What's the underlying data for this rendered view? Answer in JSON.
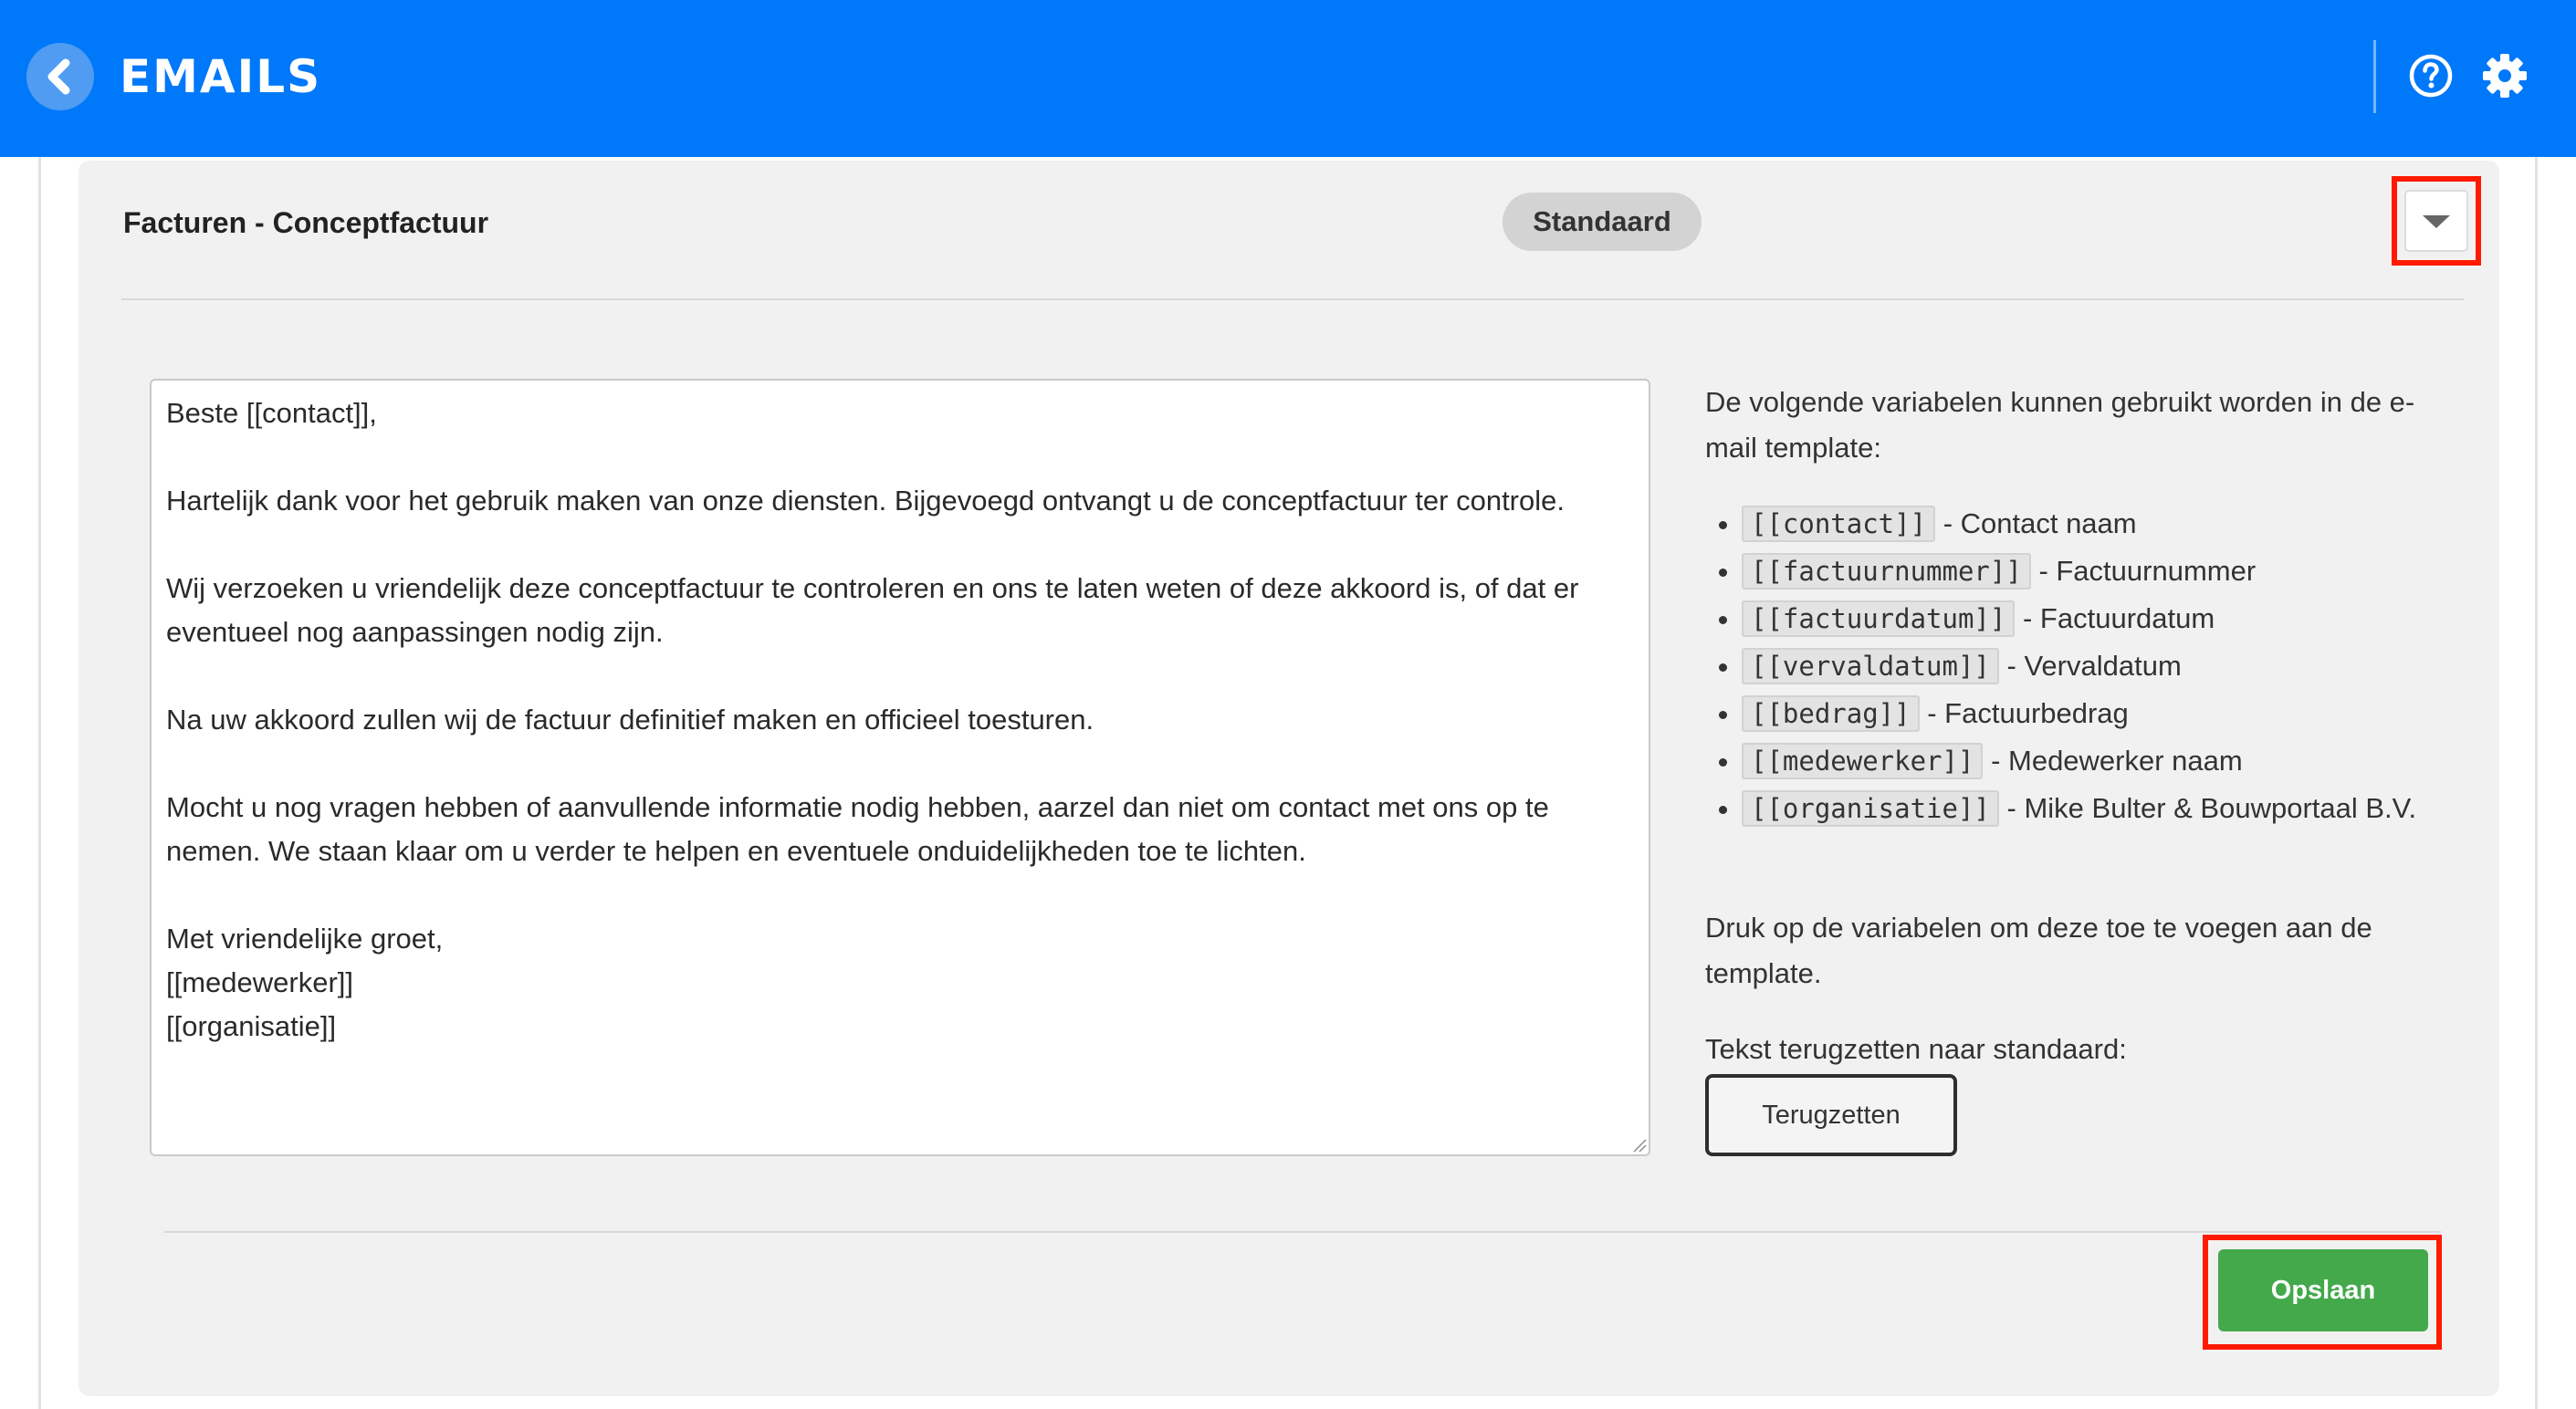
{
  "header": {
    "title": "EMAILS",
    "back_icon": "chevron-left-icon",
    "help_icon": "question-circle-icon",
    "settings_icon": "gear-icon",
    "background_color": "#0078fa"
  },
  "template": {
    "title": "Facturen - Conceptfactuur",
    "status_badge": "Standaard",
    "collapse_icon": "caret-down-icon",
    "body": "Beste [[contact]],\n\nHartelijk dank voor het gebruik maken van onze diensten. Bijgevoegd ontvangt u de conceptfactuur ter controle.\n\nWij verzoeken u vriendelijk deze conceptfactuur te controleren en ons te laten weten of deze akkoord is, of dat er eventueel nog aanpassingen nodig zijn.\n\nNa uw akkoord zullen wij de factuur definitief maken en officieel toesturen.\n\nMocht u nog vragen hebben of aanvullende informatie nodig hebben, aarzel dan niet om contact met ons op te nemen. We staan klaar om u verder te helpen en eventuele onduidelijkheden toe te lichten.\n\nMet vriendelijke groet,\n[[medewerker]]\n[[organisatie]]"
  },
  "variables": {
    "intro": "De volgende variabelen kunnen gebruikt worden in de e-mail template:",
    "items": [
      {
        "code": "[[contact]]",
        "description": "- Contact naam"
      },
      {
        "code": "[[factuurnummer]]",
        "description": "- Factuurnummer"
      },
      {
        "code": "[[factuurdatum]]",
        "description": "- Factuurdatum"
      },
      {
        "code": "[[vervaldatum]]",
        "description": "- Vervaldatum"
      },
      {
        "code": "[[bedrag]]",
        "description": "- Factuurbedrag"
      },
      {
        "code": "[[medewerker]]",
        "description": "- Medewerker naam"
      },
      {
        "code": "[[organisatie]]",
        "description": "- Mike Bulter & Bouwportaal B.V."
      }
    ],
    "hint": "Druk op de variabelen om deze toe te voegen aan de template.",
    "reset_label": "Tekst terugzetten naar standaard:",
    "reset_button": "Terugzetten"
  },
  "footer": {
    "save_button": "Opslaan",
    "save_color": "#43a94b"
  },
  "highlight_color": "#ff1a00"
}
